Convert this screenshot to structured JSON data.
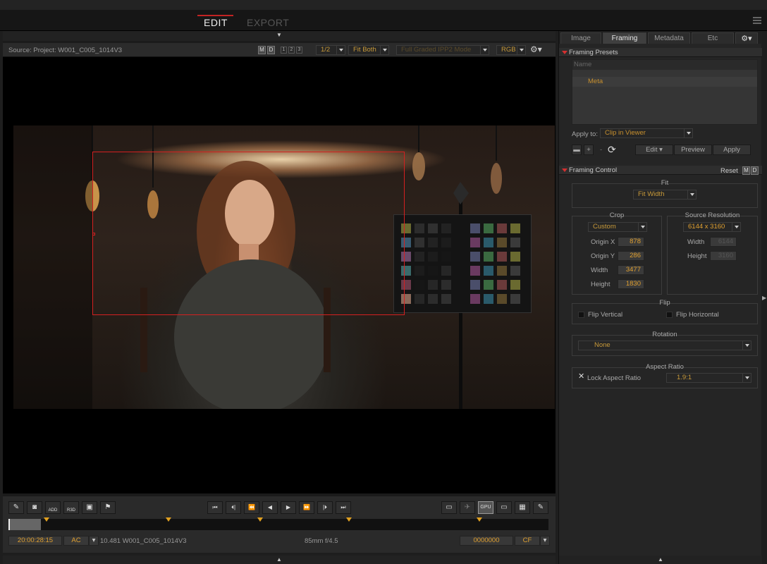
{
  "top": {
    "tabs": [
      {
        "label": "EDIT"
      },
      {
        "label": "EXPORT"
      }
    ]
  },
  "viewer": {
    "source_label": "Source: Project: W001_C005_1014V3",
    "m_label": "M",
    "d_label": "D",
    "view_nums": [
      "1",
      "2",
      "3"
    ],
    "scale": "1/2",
    "fit": "Fit Both",
    "mode": "Full Graded IPP2 Mode",
    "channel": "RGB"
  },
  "transport": {
    "add_label": "ADD",
    "r3d_label": "R3D",
    "gpu_label": "GPU",
    "timecode": "20:00:28:15",
    "tc_mode": "AC",
    "clip_info": "10.481 W001_C005_1014V3",
    "lens_info": "85mm  f/4.5",
    "frame_field": "0000000",
    "frame_mode": "CF",
    "playhead_fraction": 0.06
  },
  "panel": {
    "tabs": [
      {
        "label": "Image"
      },
      {
        "label": "Framing"
      },
      {
        "label": "Metadata"
      },
      {
        "label": "Etc"
      }
    ],
    "presets_section": "Framing Presets",
    "presets_column": "Name",
    "presets": [
      "Meta"
    ],
    "apply_to_label": "Apply to:",
    "apply_to_value": "Clip in Viewer",
    "edit_label": "Edit",
    "preview_label": "Preview",
    "apply_label": "Apply",
    "control_section": "Framing Control",
    "reset_label": "Reset",
    "fit_title": "Fit",
    "fit_value": "Fit Width",
    "crop_title": "Crop",
    "crop_mode": "Custom",
    "crop_fields": [
      {
        "label": "Origin X",
        "value": "878"
      },
      {
        "label": "Origin Y",
        "value": "286"
      },
      {
        "label": "Width",
        "value": "3477"
      },
      {
        "label": "Height",
        "value": "1830"
      }
    ],
    "source_title": "Source Resolution",
    "source_res": "6144 x 3160",
    "source_fields": [
      {
        "label": "Width",
        "value": "6144"
      },
      {
        "label": "Height",
        "value": "3160"
      }
    ],
    "flip_title": "Flip",
    "flip_vertical": "Flip Vertical",
    "flip_horizontal": "Flip Horizontal",
    "rotation_title": "Rotation",
    "rotation_value": "None",
    "aspect_title": "Aspect Ratio",
    "lock_label": "Lock Aspect Ratio",
    "aspect_value": "1.9:1"
  },
  "colors": {
    "accent": "#c32323",
    "value_orange": "#e0a030",
    "marker": "#e0a020"
  }
}
